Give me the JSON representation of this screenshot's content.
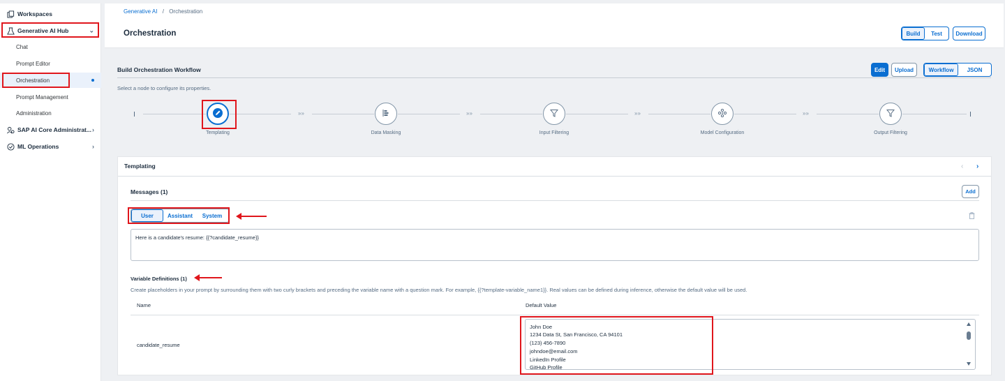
{
  "sidebar": {
    "items": [
      {
        "label": "Workspaces",
        "icon": "workspaces-icon"
      },
      {
        "label": "Generative AI Hub",
        "icon": "flask-icon"
      },
      {
        "label": "Chat"
      },
      {
        "label": "Prompt Editor"
      },
      {
        "label": "Orchestration"
      },
      {
        "label": "Prompt Management"
      },
      {
        "label": "Administration"
      },
      {
        "label": "SAP AI Core Administrat...",
        "icon": "admin-icon"
      },
      {
        "label": "ML Operations",
        "icon": "ml-ops-icon"
      }
    ]
  },
  "header": {
    "breadcrumb_root": "Generative AI",
    "breadcrumb_sep": "/",
    "breadcrumb_current": "Orchestration",
    "title": "Orchestration",
    "tab_build": "Build",
    "tab_test": "Test",
    "download_label": "Download"
  },
  "workflow": {
    "title": "Build Orchestration Workflow",
    "hint": "Select a node to configure its properties.",
    "edit_label": "Edit",
    "upload_label": "Upload",
    "view_workflow": "Workflow",
    "view_json": "JSON",
    "nodes": [
      {
        "label": "Templating",
        "icon": "templating-icon"
      },
      {
        "label": "Data Masking",
        "icon": "data-masking-icon"
      },
      {
        "label": "Input Filtering",
        "icon": "filter-icon"
      },
      {
        "label": "Model Configuration",
        "icon": "model-config-icon"
      },
      {
        "label": "Output Filtering",
        "icon": "filter-icon"
      }
    ],
    "connector": "»»"
  },
  "templating": {
    "title": "Templating",
    "messages_title": "Messages (1)",
    "add_label": "Add",
    "roles": [
      "User",
      "Assistant",
      "System"
    ],
    "selected_role": "User",
    "message_text": "Here is a candidate's resume: {{?candidate_resume}}",
    "variables_title": "Variable Definitions (1)",
    "variables_hint": "Create placeholders in your prompt by surrounding them with two curly brackets and preceding the variable name with a question mark. For example, {{?template-variable_name1}}. Real values can be defined during inference, otherwise the default value will be used.",
    "col_name": "Name",
    "col_default": "Default Value",
    "rows": [
      {
        "name": "candidate_resume",
        "default_lines": [
          "John Doe",
          "1234 Data St, San Francisco, CA 94101",
          "(123) 456-7890",
          "johndoe@email.com",
          "LinkedIn Profile",
          "GitHub Profile"
        ]
      }
    ]
  },
  "colors": {
    "accent": "#0a6ed1",
    "annotation_red": "#e0161c"
  }
}
